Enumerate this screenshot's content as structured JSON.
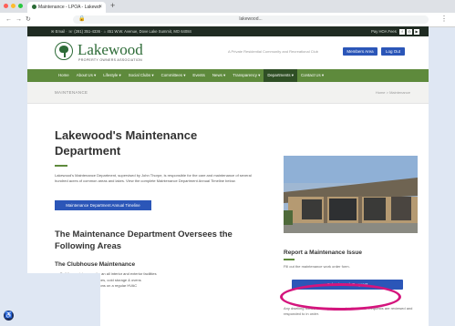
{
  "browser": {
    "tab_title": "Maintenance - LPOA - Lakewd",
    "url": "lakewood...",
    "new_tab": "+",
    "close": "×"
  },
  "topbar": {
    "left": "✉ Email  ·  ☏ (281) 351-4336  ·  ⌂ 451 W.W. Avenue, Dove Lake Summit, MO 64084",
    "right": "Pay HOA Fees"
  },
  "header": {
    "logo_text": "Lakewood",
    "logo_sub": "PROPERTY OWNERS ASSOCIATION",
    "tagline": "A Private Residential Community and Recreational Club",
    "btn1": "Members Area",
    "btn2": "Log Out"
  },
  "nav": {
    "items": [
      "Home",
      "About Us ▾",
      "Lifestyle ▾",
      "Social Clubs ▾",
      "Committees ▾",
      "Events",
      "News ▾",
      "Transparency ▾",
      "Departments ▾",
      "Contact Us ▾"
    ]
  },
  "breadcrumb": {
    "left": "MAINTENANCE",
    "right": "Home > Maintenance"
  },
  "main": {
    "title": "Lakewood's Maintenance Department",
    "intro": "Lakewood's Maintenance Department, supervised by John Thorpe, is responsible for the care and maintenance of several hundred acres of common areas and lakes. View the complete Maintenance Department Annual Timeline below.",
    "annual_btn": "Maintenance Department Annual Timeline",
    "h2": "The Maintenance Department Oversees the Following Areas",
    "h3": "The Clubhouse Maintenance",
    "bullets": [
      "Building maintenance for an all interior and exterior facilities",
      "Maintain kitchen appliances, cold storage & ovens",
      "Conduct kitchen inspections on a regular HVAC"
    ]
  },
  "sidebar": {
    "heading": "Report a Maintenance Issue",
    "text": "Fill out the maintenance work order form.",
    "submit_btn": "Submit Work Request",
    "text2": "Any dwelling issues can require are submitted here. Requests are reviewed and responded to in order."
  },
  "accessibility": "♿"
}
